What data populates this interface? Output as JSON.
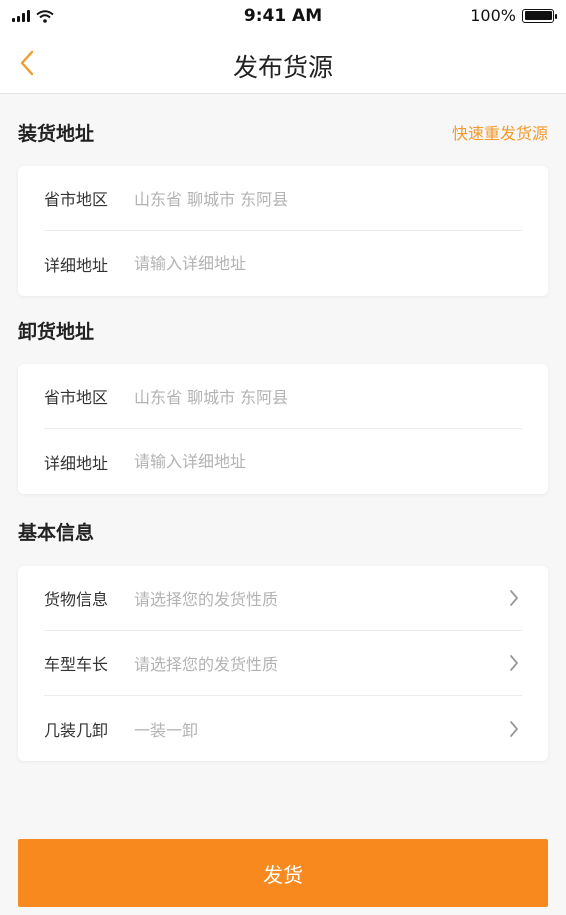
{
  "status_bar": {
    "time": "9:41 AM",
    "battery": "100%"
  },
  "nav": {
    "title": "发布货源",
    "back_icon": "chevron-left-icon"
  },
  "loading": {
    "title": "装货地址",
    "quick_link": "快速重发货源",
    "rows": [
      {
        "label": "省市地区",
        "value": "山东省 聊城市 东阿县"
      },
      {
        "label": "详细地址",
        "placeholder": "请输入详细地址"
      }
    ]
  },
  "unloading": {
    "title": "卸货地址",
    "rows": [
      {
        "label": "省市地区",
        "value": "山东省 聊城市 东阿县"
      },
      {
        "label": "详细地址",
        "placeholder": "请输入详细地址"
      }
    ]
  },
  "basic_info": {
    "title": "基本信息",
    "rows": [
      {
        "label": "货物信息",
        "value": "请选择您的发货性质"
      },
      {
        "label": "车型车长",
        "value": "请选择您的发货性质"
      },
      {
        "label": "几装几卸",
        "value": "一装一卸"
      }
    ]
  },
  "submit": {
    "label": "发货"
  },
  "colors": {
    "accent": "#f7891e",
    "link": "#f39a2c",
    "placeholder": "#b3b3b3"
  }
}
